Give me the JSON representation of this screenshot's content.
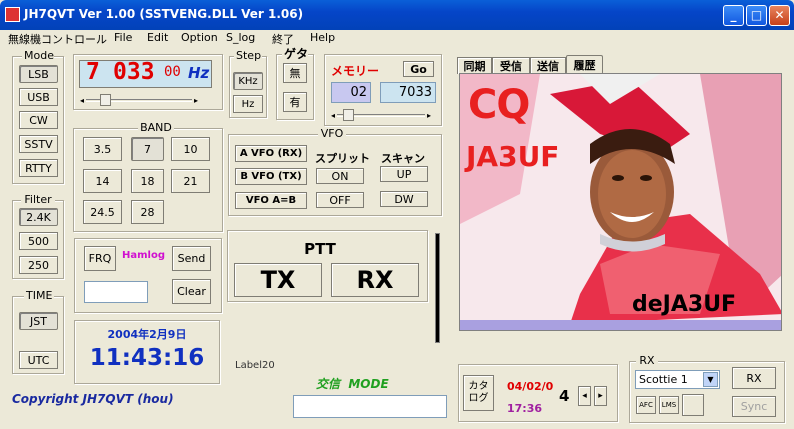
{
  "window": {
    "title": "JH7QVT  Ver 1.00 (SSTVENG.DLL Ver 1.06)",
    "min": "_",
    "max": "□",
    "close": "✕"
  },
  "menu": [
    "無線機コントロール",
    "File",
    "Edit",
    "Option",
    "S_log",
    "終了",
    "Help"
  ],
  "mode": {
    "label": "Mode",
    "items": [
      "LSB",
      "USB",
      "CW",
      "SSTV",
      "RTTY"
    ]
  },
  "filter": {
    "label": "Filter",
    "items": [
      "2.4K",
      "500",
      "250"
    ]
  },
  "time": {
    "label": "TIME",
    "jst": "JST",
    "utc": "UTC"
  },
  "freq": {
    "mhz": "7",
    "khz": "033",
    "sub": "00",
    "unit": "Hz",
    "slider_pos": 0.15
  },
  "step": {
    "label": "Step",
    "khz": "KHz",
    "hz": "Hz"
  },
  "geta": {
    "label": "ゲタ",
    "none": "無",
    "yes": "有"
  },
  "memory": {
    "label": "メモリー",
    "go": "Go",
    "slot": "02",
    "freq": "7033"
  },
  "band": {
    "label": "BAND",
    "items": [
      "3.5",
      "7",
      "10",
      "14",
      "18",
      "21",
      "24.5",
      "28"
    ]
  },
  "vfo": {
    "label": "VFO",
    "a": "A  VFO (RX)",
    "b": "B VFO (TX)",
    "ab": "VFO A=B",
    "split_label": "スプリット",
    "split_on": "ON",
    "split_off": "OFF",
    "scan_label": "スキャン",
    "up": "UP",
    "dw": "DW"
  },
  "hamlog": {
    "frq": "FRQ",
    "label": "Hamlog",
    "send": "Send",
    "clear": "Clear",
    "input": ""
  },
  "clock": {
    "date": "2004年2月9日",
    "time": "11:43:16"
  },
  "ptt": {
    "label": "PTT",
    "tx": "TX",
    "rx": "RX"
  },
  "label20": "Label20",
  "mode_display": {
    "label": "交信  MODE",
    "value": ""
  },
  "copyright": "Copyright JH7QVT (hou)",
  "tabs": [
    "同期",
    "受信",
    "送信",
    "履歴"
  ],
  "image": {
    "cq": "CQ",
    "call": "JA3UF",
    "de": "deJA3UF"
  },
  "kana": {
    "label": "カタ ログ",
    "date": "04/02/0",
    "time": "17:36",
    "count": "4",
    "left": "◂",
    "right": "▸"
  },
  "rx": {
    "label": "RX",
    "mode": "Scottie 1",
    "btn": "RX",
    "sync": "Sync",
    "afc": "AFC",
    "lms": "LMS"
  },
  "colors": {
    "titlebar": "#0545c8",
    "freq_red": "#e00000",
    "clock_blue": "#1030c0",
    "hamlog_pink": "#d010d0",
    "mode_green": "#20a020",
    "copyright_blue": "#1a2aa0"
  }
}
